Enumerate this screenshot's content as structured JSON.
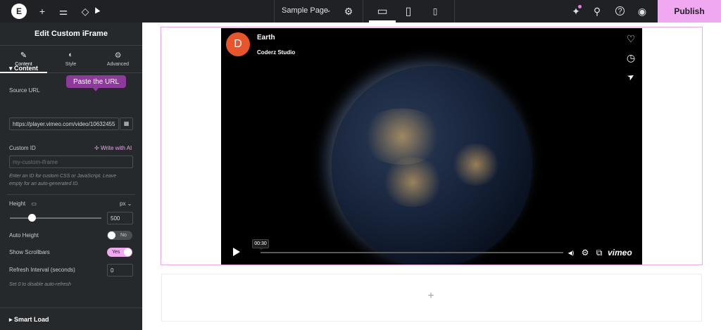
{
  "topbar": {
    "logo_letter": "E",
    "page_name": "Sample Page",
    "page_caret": "⌄",
    "publish_label": "Publish",
    "icons": {
      "add": "+",
      "settings": "⚙",
      "site_settings": "⚌",
      "layers": "◇",
      "desktop": "▭",
      "tablet": "▯",
      "mobile": "▯",
      "whats_new": "✦",
      "search": "⚲",
      "help": "?",
      "preview": "◉"
    }
  },
  "panel": {
    "title": "Edit Custom iFrame",
    "tabs": [
      {
        "label": "Content",
        "icon": "✎"
      },
      {
        "label": "Style",
        "icon": "◐"
      },
      {
        "label": "Advanced",
        "icon": "⚙"
      }
    ],
    "section_title": "Content",
    "section_caret": "▾",
    "source_url_label": "Source URL",
    "tooltip": "Paste the URL",
    "source_url_value": "https://player.vimeo.com/video/10632455",
    "source_url_icon": "▦",
    "custom_id_label": "Custom ID",
    "write_ai_label": "Write with AI",
    "write_ai_icon": "✢",
    "custom_id_placeholder": "my-custom-iframe",
    "custom_id_help_1": "Enter an ID for custom CSS or JavaScript. Leave",
    "custom_id_help_2": "empty for an auto-generated ID.",
    "height_label": "Height",
    "height_device_icon": "▭",
    "height_unit": "px ⌄",
    "height_value": "500",
    "auto_height_label": "Auto Height",
    "auto_height_toggle": "No",
    "show_scrollbars_label": "Show Scrollbars",
    "show_scrollbars_toggle": "Yes",
    "refresh_label": "Refresh Interval (seconds)",
    "refresh_value": "0",
    "refresh_help": "Set 0 to disable auto-refresh",
    "smart_load_label": "Smart Load",
    "smart_load_caret": "▸",
    "collapse_icon": "‹"
  },
  "video": {
    "channel_initial": "D",
    "title": "Earth",
    "byline": "Coderz Studio",
    "timecode": "00:30",
    "brand": "vimeo",
    "icons": {
      "like": "♡",
      "watch_later": "◷",
      "share": "➤",
      "volume": "◀)",
      "settings": "⚙",
      "pip": "⧉"
    }
  },
  "canvas": {
    "add_section_icon": "+"
  },
  "colors": {
    "accent": "#f0a8f0",
    "tooltip": "#8d3a9c",
    "panel_bg": "#26292c",
    "topbar_bg": "#1f2124",
    "channel_avatar": "#e8552b"
  }
}
